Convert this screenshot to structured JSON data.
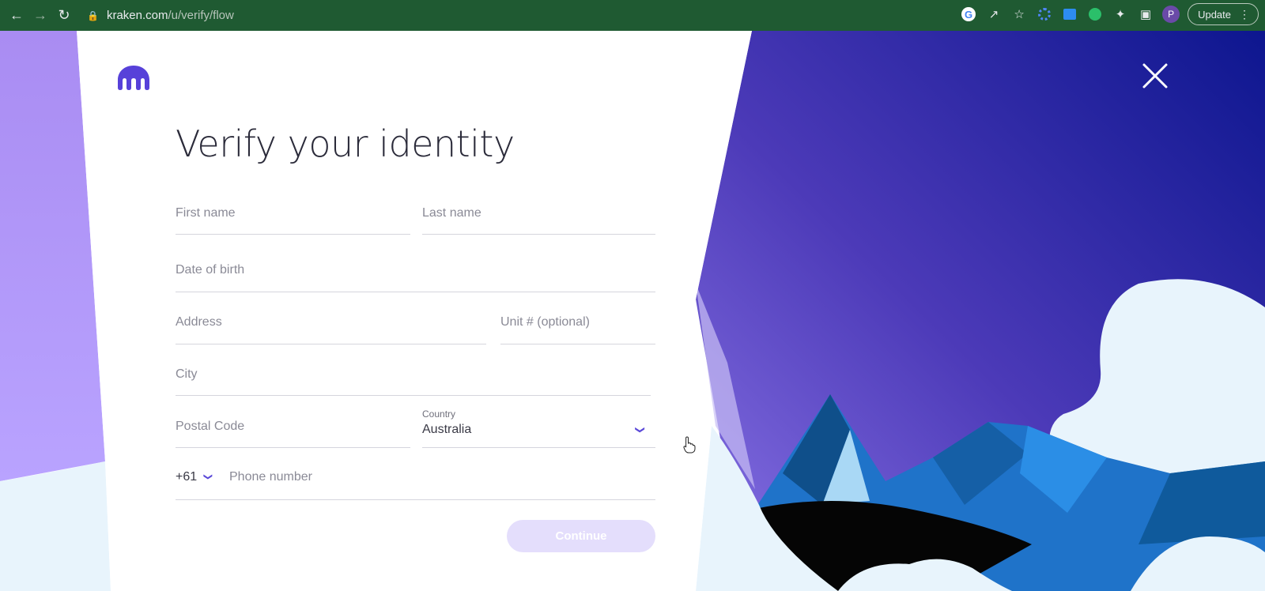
{
  "browser": {
    "url_host": "kraken.com",
    "url_path": "/u/verify/flow",
    "profile_initial": "P",
    "update_label": "Update"
  },
  "page": {
    "title": "Verify your identity",
    "colors": {
      "brand": "#5741d9",
      "sky_light": "#b79cf7",
      "sky_dark": "#0d168f",
      "button_disabled": "#e4defc"
    }
  },
  "form": {
    "first_name_placeholder": "First name",
    "last_name_placeholder": "Last name",
    "dob_placeholder": "Date of birth",
    "address_placeholder": "Address",
    "unit_placeholder": "Unit # (optional)",
    "city_placeholder": "City",
    "postal_placeholder": "Postal Code",
    "country_label": "Country",
    "country_value": "Australia",
    "dial_code": "+61",
    "phone_placeholder": "Phone number",
    "continue_label": "Continue"
  },
  "icons": [
    "back-arrow-icon",
    "forward-arrow-icon",
    "reload-icon",
    "lock-icon",
    "google-icon",
    "share-icon",
    "star-icon",
    "puzzle-icon",
    "sidepanel-icon",
    "kebab-menu-icon",
    "kraken-logo-icon",
    "close-icon",
    "chevron-down-icon",
    "hand-cursor-icon"
  ]
}
